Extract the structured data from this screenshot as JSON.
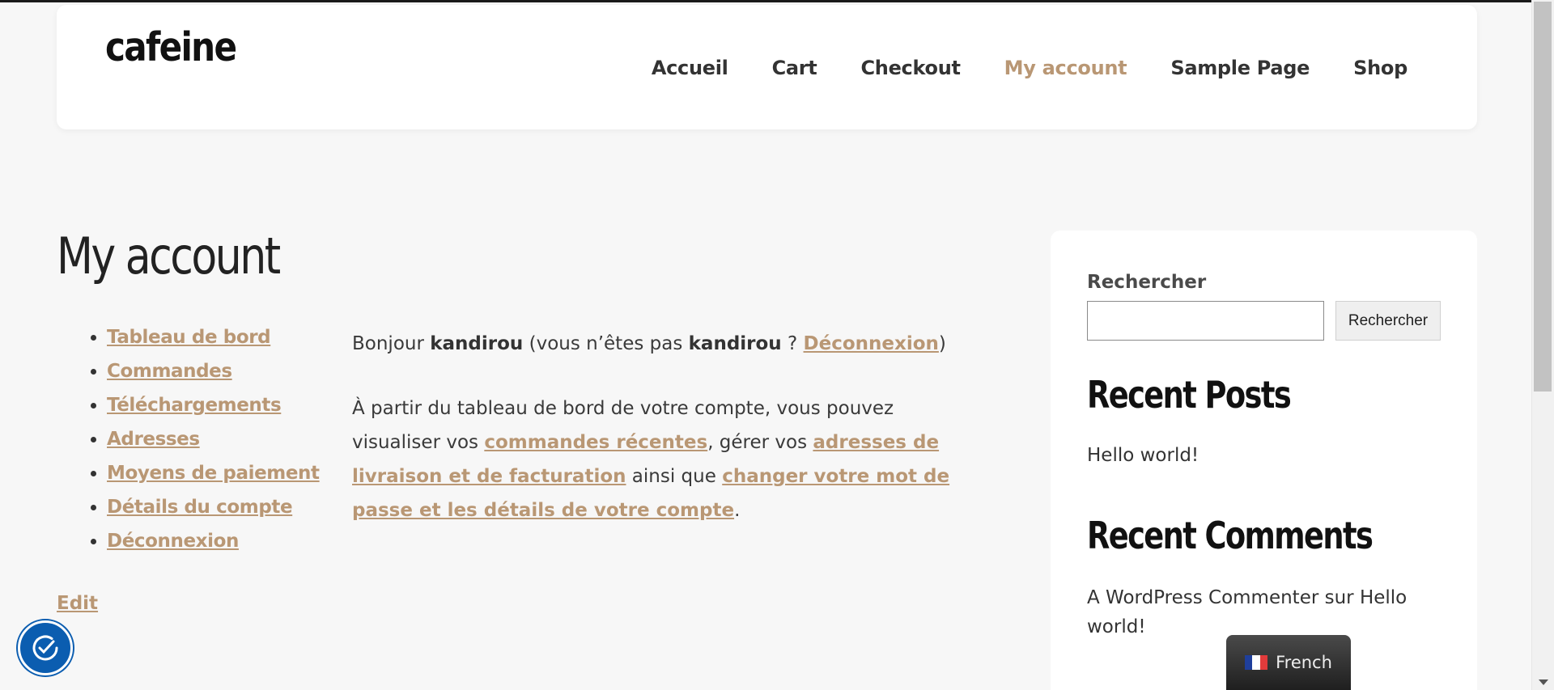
{
  "header": {
    "site_title": "cafeine",
    "nav": [
      {
        "label": "Accueil",
        "active": false
      },
      {
        "label": "Cart",
        "active": false
      },
      {
        "label": "Checkout",
        "active": false
      },
      {
        "label": "My account",
        "active": true
      },
      {
        "label": "Sample Page",
        "active": false
      },
      {
        "label": "Shop",
        "active": false
      }
    ]
  },
  "main": {
    "page_title": "My account",
    "account_nav": [
      "Tableau de bord",
      "Commandes",
      "Téléchargements",
      "Adresses",
      "Moyens de paiement",
      "Détails du compte",
      "Déconnexion"
    ],
    "greeting": {
      "prefix": "Bonjour ",
      "username": "kandirou",
      "middle": " (vous n’êtes pas ",
      "username2": "kandirou",
      "question": " ? ",
      "logout": "Déconnexion",
      "suffix": ")"
    },
    "intro": {
      "part1": "À partir du tableau de bord de votre compte, vous pouvez visualiser vos ",
      "link1": "commandes récentes",
      "part2": ", gérer vos ",
      "link2": "adresses de livraison et de facturation",
      "part3": " ainsi que ",
      "link3": "changer votre mot de passe et les détails de votre compte",
      "part4": "."
    },
    "edit_label": "Edit"
  },
  "sidebar": {
    "search_label": "Rechercher",
    "search_value": "",
    "search_button": "Rechercher",
    "recent_posts_title": "Recent Posts",
    "recent_posts": [
      "Hello world!"
    ],
    "recent_comments_title": "Recent Comments",
    "comment": {
      "author": "A WordPress Commenter",
      "on": " sur ",
      "post": "Hello world!"
    }
  },
  "widgets": {
    "a11y_icon": "accessibility-check-icon",
    "language_label": "French",
    "language_flag": "france-flag-icon"
  },
  "colors": {
    "accent": "#b99774",
    "a11y_blue": "#0b5db0"
  }
}
